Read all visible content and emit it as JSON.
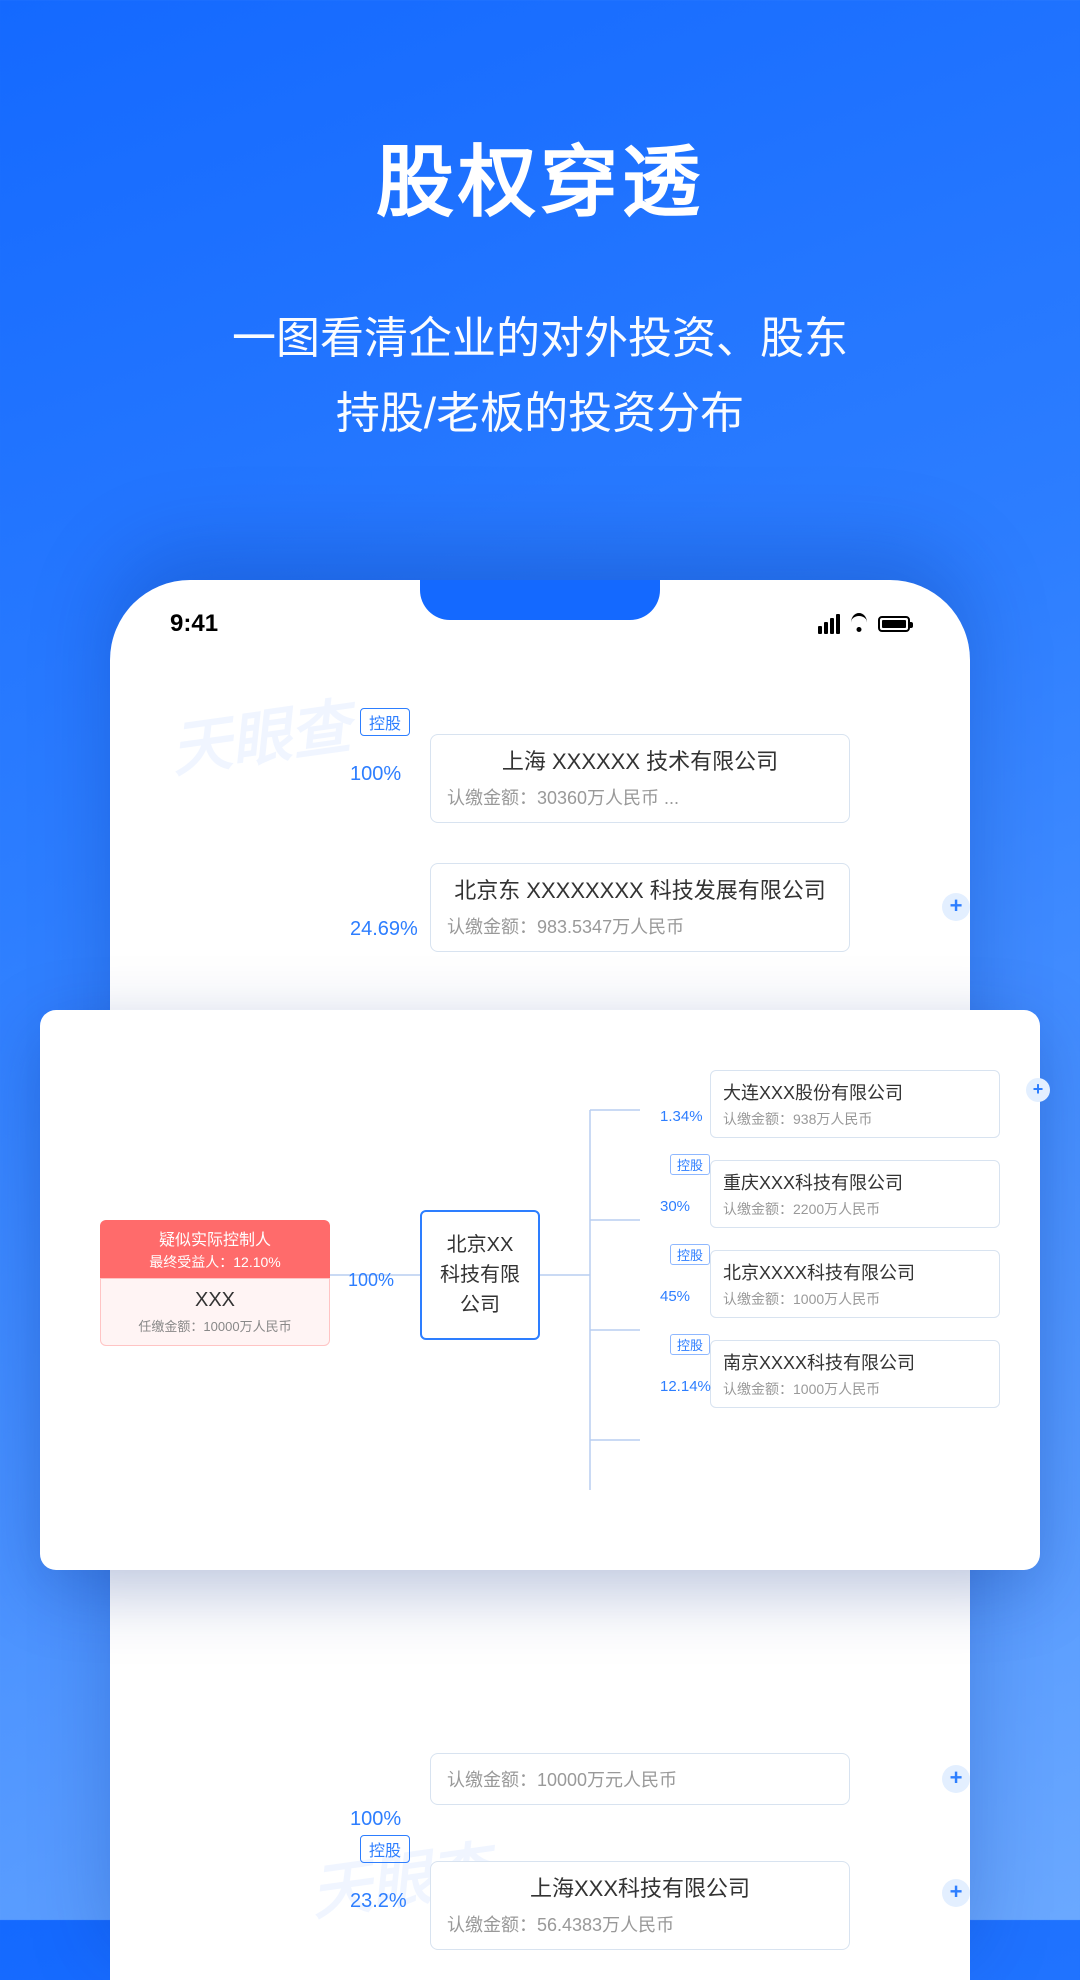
{
  "hero": {
    "title": "股权穿透",
    "subtitle_l1": "一图看清企业的对外投资、股东",
    "subtitle_l2": "持股/老板的投资分布"
  },
  "statusbar": {
    "time": "9:41"
  },
  "watermark": "天眼查",
  "back_diagram": {
    "tag_holding": "控股",
    "rows": [
      {
        "pct": "100%",
        "name": "上海 XXXXXX 技术有限公司",
        "amount": "认缴金额：30360万人民币  ...",
        "tag": true,
        "plus": false
      },
      {
        "pct": "24.69%",
        "name": "北京东 XXXXXXXX 科技发展有限公司",
        "amount": "认缴金额：983.5347万人民币",
        "tag": false,
        "plus": true
      }
    ],
    "bottom_rows": [
      {
        "pct": "100%",
        "name": "",
        "amount": "认缴金额：10000万元人民币",
        "tag": false,
        "plus": true
      },
      {
        "pct": "23.2%",
        "name": "上海XXX科技有限公司",
        "amount": "认缴金额：56.4383万人民币",
        "tag": true,
        "plus": true
      }
    ]
  },
  "overlay": {
    "root": {
      "badge1": "疑似实际控制人",
      "badge2": "最终受益人：12.10%",
      "name": "XXX",
      "sub": "任缴金额：10000万人民币",
      "pct": "100%"
    },
    "center": "北京XX\n科技有限\n公司",
    "tag_holding": "控股",
    "leaves": [
      {
        "pct": "1.34%",
        "tag": false,
        "name": "大连XXX股份有限公司",
        "amount": "认缴金额：938万人民币",
        "plus": true
      },
      {
        "pct": "30%",
        "tag": true,
        "name": "重庆XXX科技有限公司",
        "amount": "认缴金额：2200万人民币",
        "plus": false
      },
      {
        "pct": "45%",
        "tag": true,
        "name": "北京XXXX科技有限公司",
        "amount": "认缴金额：1000万人民币",
        "plus": false
      },
      {
        "pct": "12.14%",
        "tag": true,
        "name": "南京XXXX科技有限公司",
        "amount": "认缴金额：1000万人民币",
        "plus": false
      }
    ]
  }
}
